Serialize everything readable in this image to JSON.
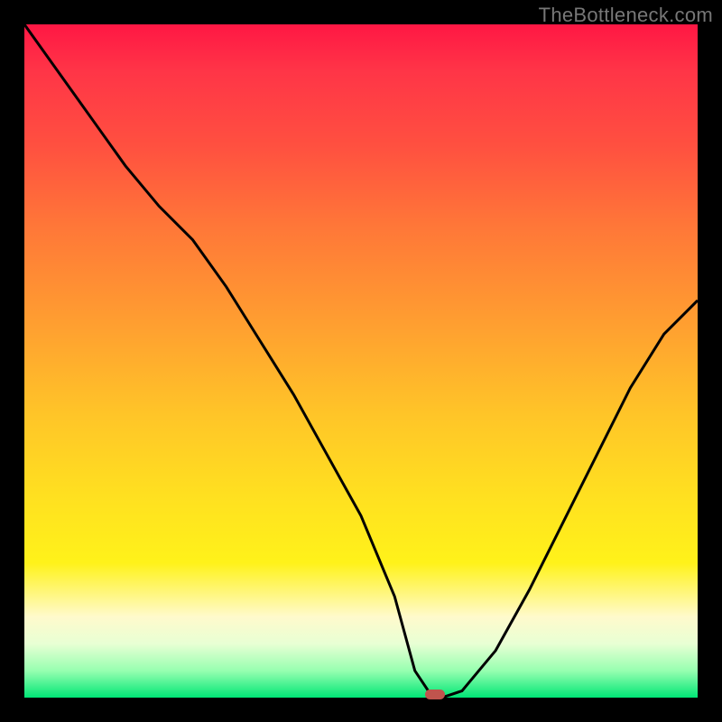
{
  "watermark": "TheBottleneck.com",
  "chart_data": {
    "type": "line",
    "title": "",
    "xlabel": "",
    "ylabel": "",
    "xlim": [
      0,
      100
    ],
    "ylim": [
      0,
      100
    ],
    "x": [
      0,
      5,
      10,
      15,
      20,
      25,
      30,
      35,
      40,
      45,
      50,
      55,
      58,
      60,
      62,
      65,
      70,
      75,
      80,
      85,
      90,
      95,
      100
    ],
    "values": [
      100,
      93,
      86,
      79,
      73,
      68,
      61,
      53,
      45,
      36,
      27,
      15,
      4,
      1,
      0,
      1,
      7,
      16,
      26,
      36,
      46,
      54,
      59
    ],
    "marker": {
      "x": 61,
      "y": 0.5,
      "color": "#c0544d"
    },
    "background_gradient": {
      "orientation": "vertical",
      "stops": [
        {
          "pos": 0.0,
          "color": "#ff1744"
        },
        {
          "pos": 0.18,
          "color": "#ff5040"
        },
        {
          "pos": 0.45,
          "color": "#ffa030"
        },
        {
          "pos": 0.7,
          "color": "#ffe020"
        },
        {
          "pos": 0.88,
          "color": "#fffacc"
        },
        {
          "pos": 1.0,
          "color": "#00e676"
        }
      ]
    }
  },
  "colors": {
    "frame": "#000000",
    "curve": "#000000",
    "watermark": "#777777",
    "marker": "#c0544d"
  }
}
